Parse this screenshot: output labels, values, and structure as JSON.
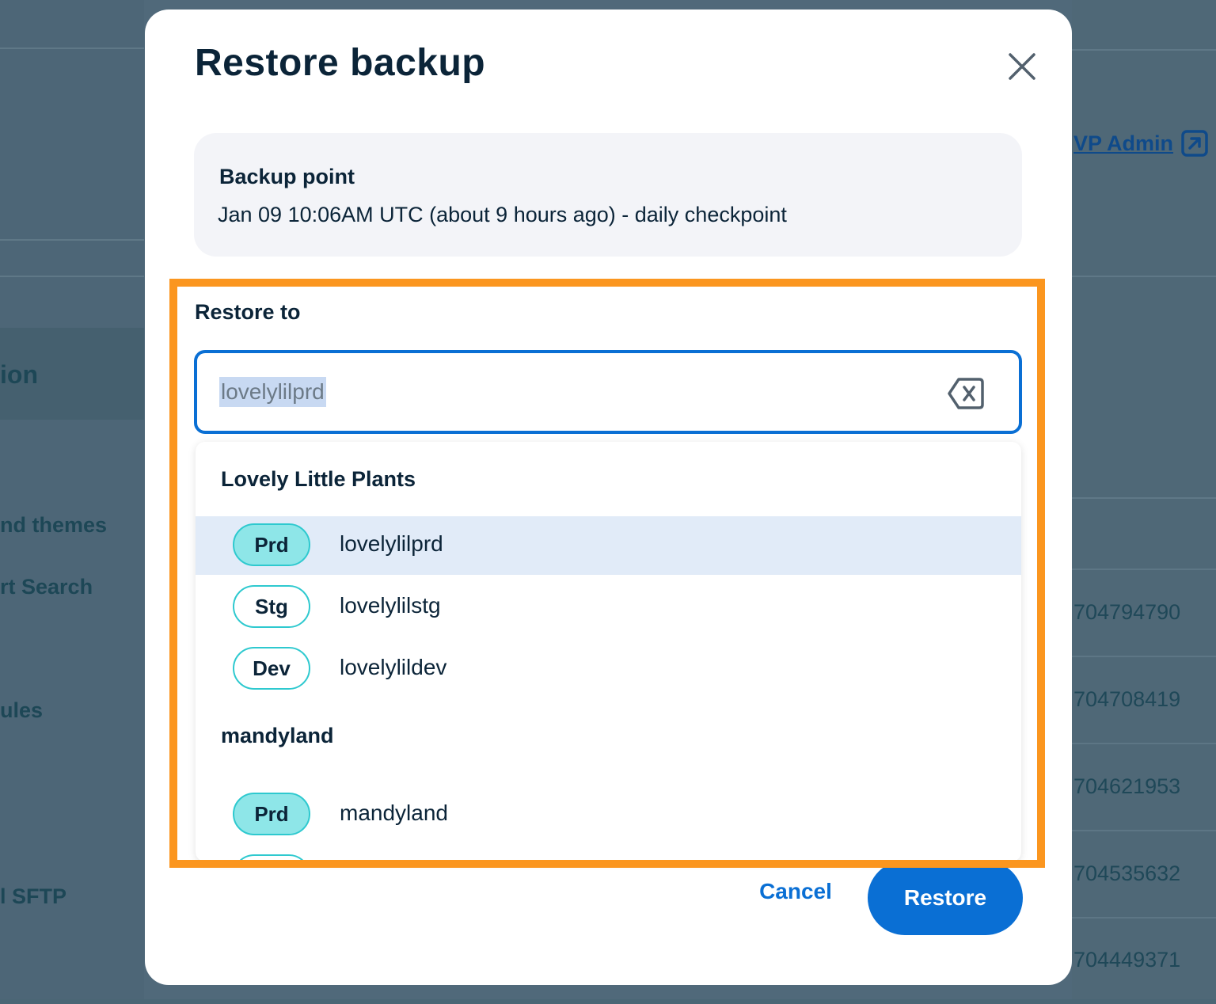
{
  "background": {
    "sidebar_items": [
      "ion",
      "nd themes",
      "rt Search",
      "ules",
      "l SFTP"
    ],
    "wp_admin_link": "VP Admin",
    "table_values": [
      "704794790",
      "704708419",
      "704621953",
      "704535632",
      "704449371"
    ]
  },
  "modal": {
    "title": "Restore backup",
    "close_icon": "close-icon",
    "backup_point": {
      "label": "Backup point",
      "value": "Jan 09 10:06AM UTC (about 9 hours ago) - daily checkpoint"
    },
    "restore_to": {
      "label": "Restore to",
      "input_value": "lovelylilprd",
      "clear_icon": "backspace-clear-icon"
    },
    "dropdown": {
      "groups": [
        {
          "name": "Lovely Little Plants",
          "options": [
            {
              "env": "Prd",
              "name": "lovelylilprd"
            },
            {
              "env": "Stg",
              "name": "lovelylilstg"
            },
            {
              "env": "Dev",
              "name": "lovelylildev"
            }
          ]
        },
        {
          "name": "mandyland",
          "options": [
            {
              "env": "Prd",
              "name": "mandyland"
            }
          ]
        }
      ]
    },
    "actions": {
      "cancel_label": "Cancel",
      "restore_label": "Restore"
    }
  },
  "colors": {
    "accent": "#0a6fd4",
    "highlight": "#fb961f",
    "badge_prd": "#8ee6e8",
    "badge_border": "#2ec9cf",
    "selected_row": "#e1ebf8"
  }
}
